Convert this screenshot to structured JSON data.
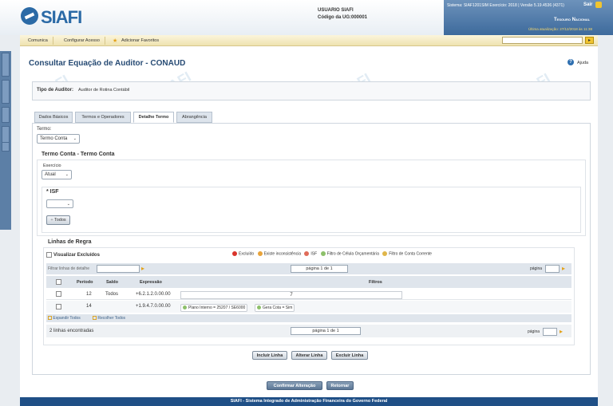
{
  "app": {
    "name": "SIAFI"
  },
  "header": {
    "user_label": "USUARIO SIAFI",
    "ug_label": "Código da UG:",
    "ug_value": "000001",
    "system_info": "Sistema: SIAF1201SIM Exercício: 2018 | Versão 5.19.4536 (4371)",
    "logout": "Sair",
    "treasury": "Tesouro Nacional",
    "last_update": "Última atualização: 27/12/2018 às 11:38"
  },
  "menu": [
    "Comunica",
    "Configurar Acesso",
    "Adicionar Favoritos"
  ],
  "page": {
    "title": "Consultar Equação de Auditor - CONAUD",
    "help": "Ajuda",
    "tipo_label": "Tipo de Auditor:",
    "tipo_value": "Auditor de Rotina Contábil"
  },
  "tabs": [
    "Dados Básicos",
    "Termos e Operadores",
    "Detalhe Termo",
    "Abrangência"
  ],
  "termo": {
    "label": "Termo:",
    "value": "Termo Conta"
  },
  "termo_conta": {
    "title": "Termo Conta - Termo Conta",
    "exercicio_label": "Exercício",
    "exercicio_value": "Atual",
    "isf_label": "* ISF",
    "todos": "Todos"
  },
  "linhas": {
    "title": "Linhas de Regra",
    "visualizar": "Visualizar Excluídos",
    "legend": [
      {
        "label": "Excluído",
        "color": "#d9342b"
      },
      {
        "label": "Existe inconsistência",
        "color": "#e8a33a"
      },
      {
        "label": "ISF",
        "color": "#e06c5a"
      },
      {
        "label": "Filtro de Célula Orçamentária",
        "color": "#8dc06a"
      },
      {
        "label": "Filtro de Conta Corrente",
        "color": "#e0b64a"
      }
    ],
    "filter_placeholder": "Filtrar linhas de detalhe",
    "pager_text": "página 1 de 1",
    "pagina_label": "página",
    "columns": [
      "Período",
      "Saldo",
      "Expressão",
      "Filtros"
    ],
    "rows": [
      {
        "periodo": "12",
        "saldo": "Todos",
        "expressao": "+6.2.1.2.0.00.00",
        "filtro": "7"
      },
      {
        "periodo": "14",
        "saldo": "",
        "expressao": "+1.9.4.7.0.00.00",
        "chips": [
          "Plano Interno = 25207 / SE6000",
          "Gera Cota = Sim"
        ]
      }
    ],
    "expand": "Expandir Todos",
    "collapse": "Recolher Todos",
    "count": "2 linhas encontradas"
  },
  "actions": {
    "incluir": "Incluir Linha",
    "alterar": "Alterar Linha",
    "excluir": "Excluir Linha"
  },
  "bottom": {
    "confirmar": "Confirmar Alteração",
    "retornar": "Retornar"
  },
  "footer": "SIAFI - Sistema Integrado de Administração Financeira do Governo Federal"
}
